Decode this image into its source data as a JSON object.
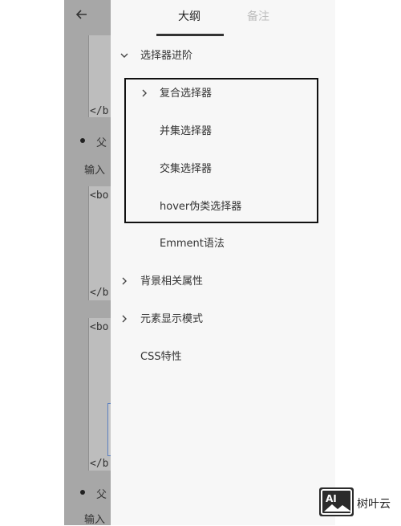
{
  "background": {
    "code_lines": [
      "</b",
      "<bo",
      "</b",
      "<bo",
      "</b"
    ],
    "bullet_texts": [
      "父",
      "父"
    ],
    "input_labels": [
      "输入",
      "输入"
    ]
  },
  "drawer": {
    "tabs": [
      {
        "label": "大纲",
        "active": true
      },
      {
        "label": "备注",
        "active": false
      }
    ],
    "outline": [
      {
        "label": "选择器进阶",
        "chevron": "chevron-down-icon",
        "level": 0
      },
      {
        "label": "复合选择器",
        "chevron": "chevron-right-icon",
        "level": 1
      },
      {
        "label": "并集选择器",
        "chevron": "",
        "level": 1
      },
      {
        "label": "交集选择器",
        "chevron": "",
        "level": 1
      },
      {
        "label": "hover伪类选择器",
        "chevron": "",
        "level": 1
      },
      {
        "label": "Emment语法",
        "chevron": "",
        "level": 1
      },
      {
        "label": "背景相关属性",
        "chevron": "chevron-right-icon",
        "level": 0
      },
      {
        "label": "元素显示模式",
        "chevron": "chevron-right-icon",
        "level": 0
      },
      {
        "label": "CSS特性",
        "chevron": "",
        "level": 0
      }
    ]
  },
  "watermark": {
    "logo_text": "AI",
    "text": "树叶云"
  },
  "colors": {
    "dim_background": "#a7a7a7",
    "drawer": "#f7f7f7",
    "active_tab": "#222222",
    "inactive_tab": "#bdbdbd",
    "highlight_border": "#111111"
  }
}
